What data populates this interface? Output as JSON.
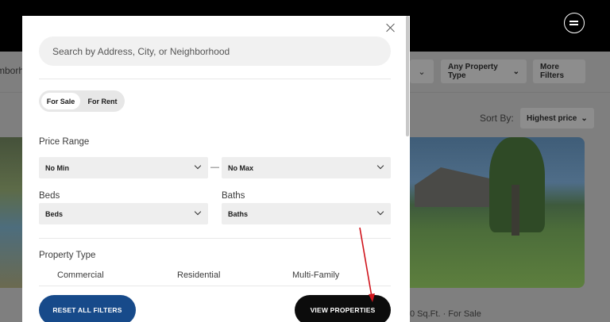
{
  "background": {
    "neighborhood_partial": "mborho",
    "property_type_filter": "Any Property Type",
    "more_filters": "More Filters",
    "sort_by_label": "Sort By:",
    "sort_value": "Highest price",
    "listing_caption_partial": "0 Sq.Ft. · For Sale"
  },
  "modal": {
    "search_placeholder": "Search by Address, City, or Neighborhood",
    "listing_tabs": [
      "For Sale",
      "For Rent"
    ],
    "price_range": {
      "label": "Price Range",
      "min": "No Min",
      "separator": "—",
      "max": "No Max"
    },
    "beds": {
      "label": "Beds",
      "value": "Beds"
    },
    "baths": {
      "label": "Baths",
      "value": "Baths"
    },
    "property_type": {
      "label": "Property Type",
      "options": [
        "Commercial",
        "Residential",
        "Multi-Family"
      ]
    },
    "reset_button": "RESET ALL FILTERS",
    "view_button": "VIEW PROPERTIES"
  },
  "colors": {
    "reset_button": "#174a8a",
    "view_button": "#0c0c0c",
    "annotation_arrow": "#d0141c"
  }
}
